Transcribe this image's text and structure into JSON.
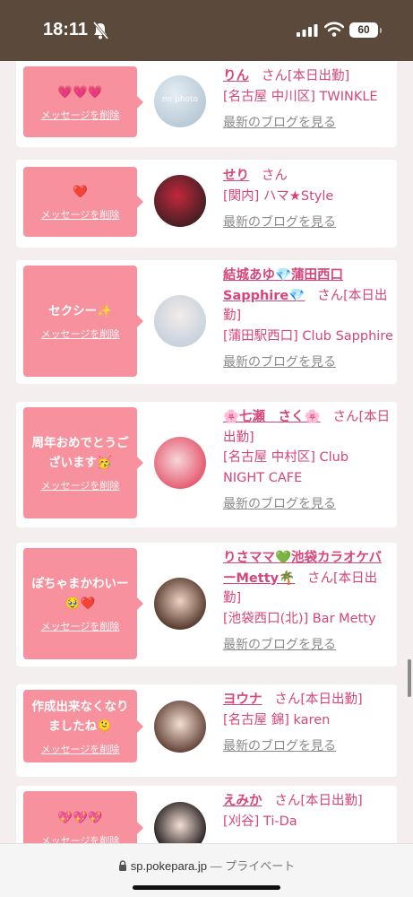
{
  "status": {
    "time": "18:11",
    "battery": "60"
  },
  "browser": {
    "url": "sp.pokepara.jp",
    "separator": "—",
    "privacy": "プライベート"
  },
  "entries": [
    {
      "message": "💗💗💗",
      "delete_label": "メッセージを削除",
      "avatar_text": "no photo",
      "name": "りん",
      "san": "さん",
      "status": "[本日出勤]",
      "shop": "[名古屋 中川区] TWINKLE",
      "blog_link": "最新のブログを見る"
    },
    {
      "message": "❤️",
      "delete_label": "メッセージを削除",
      "name": "せり",
      "san": "さん",
      "status": "",
      "shop": "[関内] ハマ★Style",
      "blog_link": "最新のブログを見る"
    },
    {
      "message": "セクシー✨",
      "delete_label": "メッセージを削除",
      "name": "結城あゆ💎蒲田西口Sapphire💎",
      "san": "さん",
      "status": "[本日出勤]",
      "shop": "[蒲田駅西口] Club Sapphire",
      "blog_link": "最新のブログを見る"
    },
    {
      "message": "周年おめでとうございます🥳",
      "delete_label": "メッセージを削除",
      "name": "🌸七瀬　さく🌸",
      "san": "さん",
      "status": "[本日出勤]",
      "shop": "[名古屋 中村区] Club NIGHT CAFE",
      "blog_link": "最新のブログを見る"
    },
    {
      "message": "ぽちゃまかわいー🥹❤️",
      "delete_label": "メッセージを削除",
      "name": "りさママ💚池袋カラオケバーMetty🌴",
      "san": "さん",
      "status": "[本日出勤]",
      "shop": "[池袋西口(北)] Bar Metty",
      "blog_link": "最新のブログを見る"
    },
    {
      "message": "作成出来なくなりましたね🫠",
      "delete_label": "メッセージを削除",
      "name": "ヨウナ",
      "san": "さん",
      "status": "[本日出勤]",
      "shop": "[名古屋 錦] karen",
      "blog_link": "最新のブログを見る"
    },
    {
      "message": "💖💖💖",
      "delete_label": "メッセージを削除",
      "name": "えみか",
      "san": "さん",
      "status": "[本日出勤]",
      "shop": "[刈谷] Ti-Da",
      "blog_link": ""
    }
  ],
  "colors": {
    "bubble": "#f7919e",
    "name": "#d6457b",
    "status_bar": "#5b4a3b"
  }
}
